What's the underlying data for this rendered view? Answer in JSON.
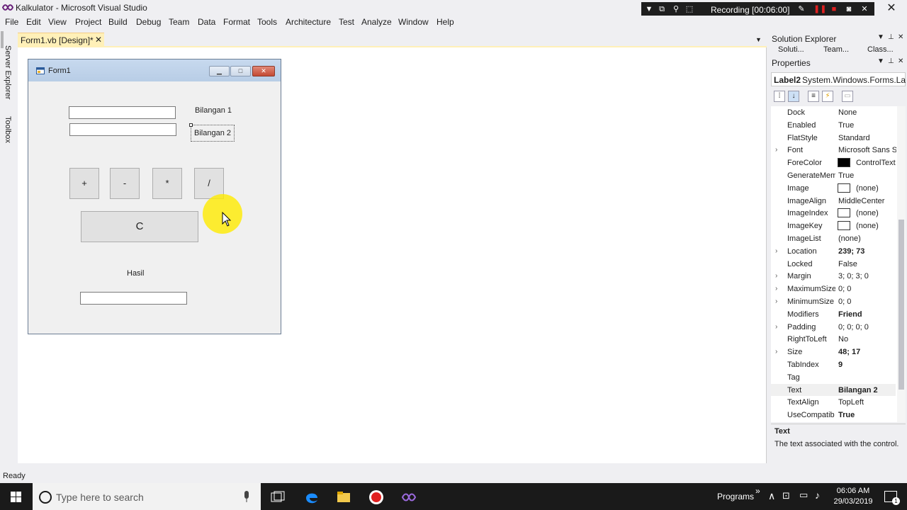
{
  "window": {
    "title": "Kalkulator - Microsoft Visual Studio",
    "recording": "Recording [00:06:00]"
  },
  "menu": [
    "File",
    "Edit",
    "View",
    "Project",
    "Build",
    "Debug",
    "Team",
    "Data",
    "Format",
    "Tools",
    "Architecture",
    "Test",
    "Analyze",
    "Window",
    "Help"
  ],
  "left_strip": {
    "server_explorer": "Server Explorer",
    "toolbox": "Toolbox"
  },
  "doc_tab": {
    "label": "Form1.vb [Design]*",
    "close": "✕"
  },
  "form1": {
    "title": "Form1",
    "labels": {
      "bilangan1": "Bilangan 1",
      "bilangan2": "Bilangan 2",
      "hasil": "Hasil"
    },
    "buttons": {
      "plus": "+",
      "minus": "-",
      "multiply": "*",
      "divide": "/",
      "clear": "C"
    }
  },
  "solution_explorer": {
    "title": "Solution Explorer",
    "tabs": [
      "Soluti...",
      "Team...",
      "Class..."
    ]
  },
  "properties": {
    "title": "Properties",
    "object_name": "Label2",
    "object_type": "System.Windows.Forms.La",
    "rows": [
      {
        "name": "Dock",
        "value": "None",
        "expand": false,
        "bold": false
      },
      {
        "name": "Enabled",
        "value": "True",
        "expand": false,
        "bold": false
      },
      {
        "name": "FlatStyle",
        "value": "Standard",
        "expand": false,
        "bold": false
      },
      {
        "name": "Font",
        "value": "Microsoft Sans S",
        "expand": true,
        "bold": false
      },
      {
        "name": "ForeColor",
        "value": "ControlText",
        "expand": false,
        "bold": false,
        "swatch": "#000000"
      },
      {
        "name": "GenerateMem",
        "value": "True",
        "expand": false,
        "bold": false
      },
      {
        "name": "Image",
        "value": "(none)",
        "expand": false,
        "bold": false,
        "swatch": "#ffffff"
      },
      {
        "name": "ImageAlign",
        "value": "MiddleCenter",
        "expand": false,
        "bold": false
      },
      {
        "name": "ImageIndex",
        "value": "(none)",
        "expand": false,
        "bold": false,
        "swatch": "#ffffff"
      },
      {
        "name": "ImageKey",
        "value": "(none)",
        "expand": false,
        "bold": false,
        "swatch": "#ffffff"
      },
      {
        "name": "ImageList",
        "value": "(none)",
        "expand": false,
        "bold": false
      },
      {
        "name": "Location",
        "value": "239; 73",
        "expand": true,
        "bold": true
      },
      {
        "name": "Locked",
        "value": "False",
        "expand": false,
        "bold": false
      },
      {
        "name": "Margin",
        "value": "3; 0; 3; 0",
        "expand": true,
        "bold": false
      },
      {
        "name": "MaximumSize",
        "value": "0; 0",
        "expand": true,
        "bold": false
      },
      {
        "name": "MinimumSize",
        "value": "0; 0",
        "expand": true,
        "bold": false
      },
      {
        "name": "Modifiers",
        "value": "Friend",
        "expand": false,
        "bold": true
      },
      {
        "name": "Padding",
        "value": "0; 0; 0; 0",
        "expand": true,
        "bold": false
      },
      {
        "name": "RightToLeft",
        "value": "No",
        "expand": false,
        "bold": false
      },
      {
        "name": "Size",
        "value": "48; 17",
        "expand": true,
        "bold": true
      },
      {
        "name": "TabIndex",
        "value": "9",
        "expand": false,
        "bold": true
      },
      {
        "name": "Tag",
        "value": "",
        "expand": false,
        "bold": false
      },
      {
        "name": "Text",
        "value": "Bilangan 2",
        "expand": false,
        "bold": true
      },
      {
        "name": "TextAlign",
        "value": "TopLeft",
        "expand": false,
        "bold": false
      },
      {
        "name": "UseCompatib",
        "value": "True",
        "expand": false,
        "bold": true
      }
    ],
    "description": {
      "heading": "Text",
      "text": "The text associated with the control."
    }
  },
  "statusbar": {
    "text": "Ready"
  },
  "taskbar": {
    "search_placeholder": "Type here to search",
    "programs": "Programs",
    "time": "06:06 AM",
    "date": "29/03/2019",
    "notifications": "1"
  }
}
